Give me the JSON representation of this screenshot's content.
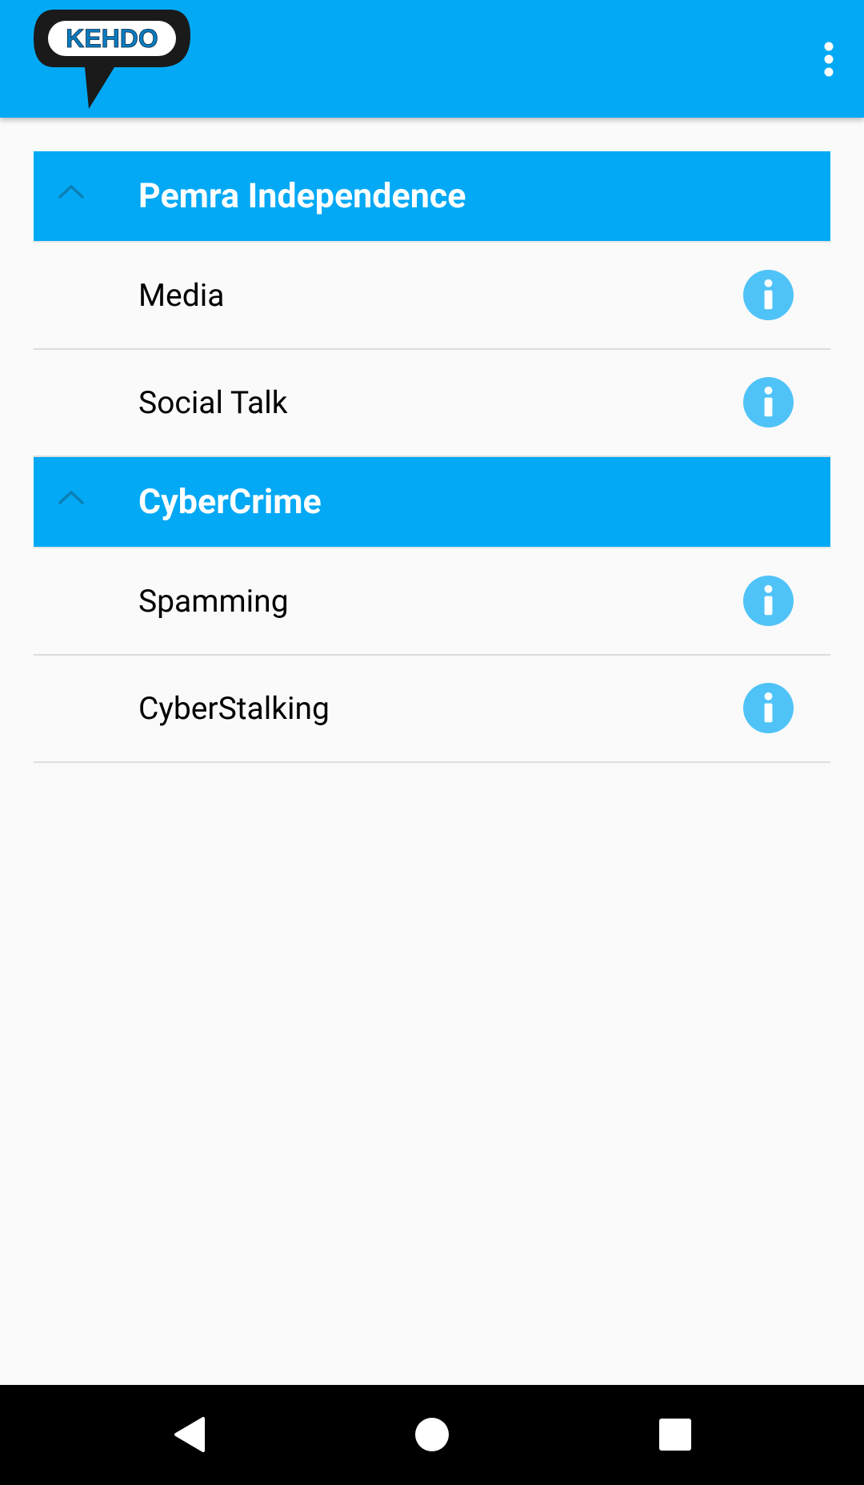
{
  "app": {
    "logo_text": "KEHDO",
    "menu_icon": "more-vert-icon"
  },
  "colors": {
    "accent": "#03a9f4",
    "info": "#4fc3f7",
    "chevron": "#0b7fb5"
  },
  "groups": [
    {
      "title": "Pemra Independence",
      "expanded": true,
      "items": [
        {
          "label": "Media",
          "icon": "info-icon"
        },
        {
          "label": "Social Talk",
          "icon": "info-icon"
        }
      ]
    },
    {
      "title": "CyberCrime",
      "expanded": true,
      "items": [
        {
          "label": "Spamming",
          "icon": "info-icon"
        },
        {
          "label": "CyberStalking",
          "icon": "info-icon"
        }
      ]
    }
  ],
  "navbar": {
    "back_icon": "back-icon",
    "home_icon": "home-icon",
    "recents_icon": "recents-icon"
  }
}
